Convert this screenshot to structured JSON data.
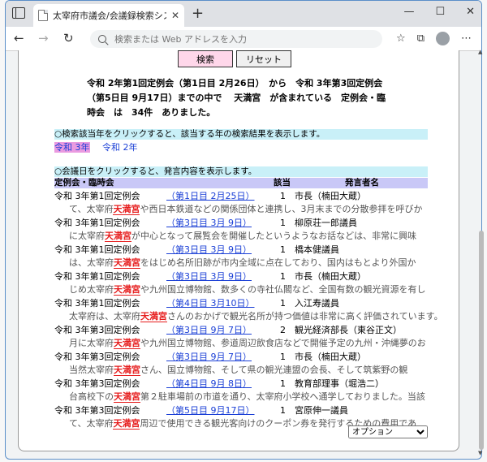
{
  "browser": {
    "tab_title": "太宰府市議会/会議録検索システム",
    "tab_close": "✕",
    "new_tab": "+",
    "address_placeholder": "検索または Web アドレスを入力",
    "controls": {
      "minimize": "—",
      "maximize": "☐",
      "close": "✕"
    },
    "nav": {
      "back": "←",
      "forward": "→",
      "reload": "↻"
    },
    "toolbar_icons": [
      "☆",
      "⧉",
      "⋯"
    ]
  },
  "page": {
    "search_button": "検索",
    "reset_button": "リセット",
    "summary_line1": "令和 2年第1回定例会（第1日目 2月26日）　から　令和 3年第3回定例会",
    "summary_line2": "（第5日目 9月17日）までの中で　 天満宮　が含まれている　定例会・臨",
    "summary_line3": "時会　は　34件　ありました。",
    "year_bar_text": "○検索該当年をクリックすると、該当する年の検索結果を表示します。",
    "year_links": [
      "令和 3年",
      "令和 2年"
    ],
    "date_bar_text": "○会議日をクリックすると、発言内容を表示します。",
    "headers": {
      "session": "定例会・臨時会",
      "count": "該当",
      "speaker": "発言者名"
    },
    "keyword": "天満宮",
    "results": [
      {
        "session": "令和 3年第1回定例会",
        "date": "（第1日目 2月25日）",
        "count": "1",
        "speaker": "市長（楠田大蔵）",
        "pre": "て、太宰府",
        "post": "や西日本鉄道などの関係団体と連携し、3月末までの分散参拝を呼びか"
      },
      {
        "session": "令和 3年第1回定例会",
        "date": "（第3日目 3月 9日）",
        "count": "1",
        "speaker": "柳原荘一郎議員",
        "pre": "に太宰府",
        "post": "が中心となって展覧会を開催したというようなお話などは、非常に興味"
      },
      {
        "session": "令和 3年第1回定例会",
        "date": "（第3日目 3月 9日）",
        "count": "1",
        "speaker": "橋本健議員",
        "pre": "は、太宰府",
        "post": "をはじめ名所旧跡が市内全域に点在しており、国内はもとより外国か"
      },
      {
        "session": "令和 3年第1回定例会",
        "date": "（第3日目 3月 9日）",
        "count": "1",
        "speaker": "市長（楠田大蔵）",
        "pre": "じめ太宰府",
        "post": "や九州国立博物館、数多くの寺社仏閣など、全国有数の観光資源を有し"
      },
      {
        "session": "令和 3年第1回定例会",
        "date": "（第4日目 3月10日）",
        "count": "1",
        "speaker": "入江寿議員",
        "pre": "太宰府は、太宰府",
        "post": "さんのおかげで観光名所が持つ価値は非常に高く評価されています。"
      },
      {
        "session": "令和 3年第3回定例会",
        "date": "（第3日目 9月 7日）",
        "count": "2",
        "speaker": "観光経済部長（東谷正文）",
        "pre": "月に太宰府",
        "post": "や九州国立博物館、参道周辺飲食店などで開催予定の九州・沖縄夢のお"
      },
      {
        "session": "令和 3年第3回定例会",
        "date": "（第3日目 9月 7日）",
        "count": "1",
        "speaker": "市長（楠田大蔵）",
        "pre": "当然太宰府",
        "post": "さん、国立博物館、そして県の観光連盟の会長、そして筑紫野の観"
      },
      {
        "session": "令和 3年第3回定例会",
        "date": "（第4日目 9月 8日）",
        "count": "1",
        "speaker": "教育部理事（堀浩二）",
        "pre": "台高校下の",
        "post": "第２駐車場前の市道を通り、太宰府小学校へ通学しておりました。当該"
      },
      {
        "session": "令和 3年第3回定例会",
        "date": "（第5日目 9月17日）",
        "count": "1",
        "speaker": "宮原伸一議員",
        "pre": "て、太宰府",
        "post": "周辺で使用できる観光客向けのクーポン券を発行するための費用であ"
      }
    ],
    "option_select": "オプション"
  }
}
